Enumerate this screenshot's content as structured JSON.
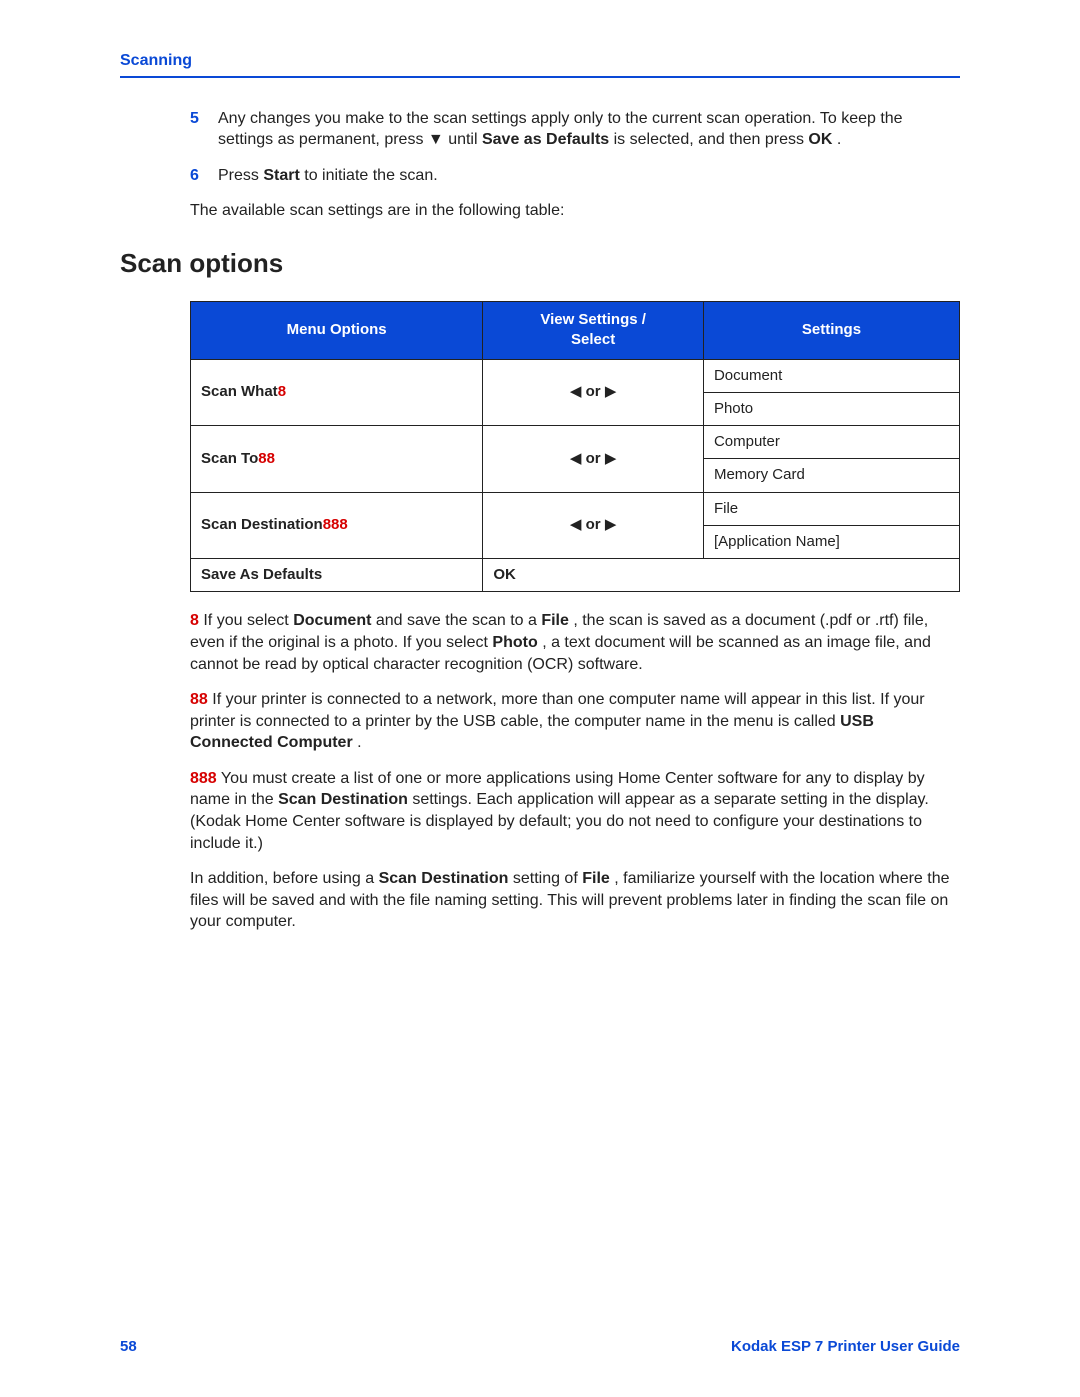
{
  "header": {
    "section": "Scanning"
  },
  "steps": {
    "s5_num": "5",
    "s5_a": "Any changes you make to the scan settings apply only to the current scan operation. To keep the settings as permanent, press ",
    "s5_b": " until ",
    "s5_c": "Save as Defaults",
    "s5_d": " is selected, and then press ",
    "s5_e": "OK",
    "s5_f": ".",
    "s6_num": "6",
    "s6_a": "Press ",
    "s6_b": "Start",
    "s6_c": " to initiate the scan."
  },
  "intro_after_steps": "The available scan settings are in the following table:",
  "heading": "Scan options",
  "table": {
    "h1": "Menu Options",
    "h2a": "View Settings /",
    "h2b": "Select",
    "h3": "Settings",
    "r1c1": "Scan What",
    "r1_marker": "8",
    "lr_or": "  or  ",
    "left_tri": "◀",
    "right_tri": "▶",
    "down_tri": "▼",
    "r1s1": "Document",
    "r1s2": "Photo",
    "r2c1": "Scan To",
    "r2_marker": "88",
    "r2s1": "Computer",
    "r2s2": "Memory Card",
    "r3c1": "Scan Destination",
    "r3_marker": "888",
    "r3s1": "File",
    "r3s2": "[Application Name]",
    "r4c1": "Save As Defaults",
    "r4c2": "OK"
  },
  "notes": {
    "n1_marker": "8",
    "n1_a": " If you select ",
    "n1_b": "Document",
    "n1_c": " and save the scan to a ",
    "n1_d": "File",
    "n1_e": ", the scan is saved as a document (.pdf or .rtf) file, even if the original is a photo. If you select ",
    "n1_f": "Photo",
    "n1_g": ", a text document will be scanned as an image file, and cannot be read by optical character recognition (OCR) software.",
    "n2_marker": "88",
    "n2_a": "If your printer is connected to a network, more than one computer name will appear in this list. If your printer is connected to a printer by the USB cable, the computer name in the menu is called ",
    "n2_b": "USB Connected Computer",
    "n2_c": ".",
    "n3_marker": "888",
    "n3_a": "You must create a list of one or more applications using Home Center software for any to display by name in the ",
    "n3_b": "Scan Destination",
    "n3_c": " settings. Each application will appear as a separate setting in the display. (Kodak Home Center software is displayed by default; you do not need to configure your destinations to include it.)",
    "n4_a": " In addition, before using a ",
    "n4_b": "Scan Destination",
    "n4_c": " setting of ",
    "n4_d": "File",
    "n4_e": ", familiarize yourself with the location where the files will be saved and with the file naming setting. This will prevent problems later in finding the scan file on your computer."
  },
  "footer": {
    "page": "58",
    "guide": "Kodak ESP 7 Printer User Guide"
  }
}
